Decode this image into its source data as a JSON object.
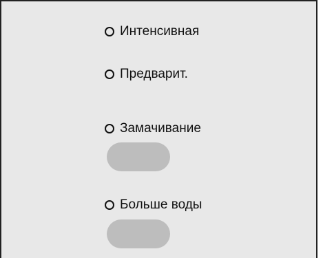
{
  "panel": {
    "background": "#e8e8e8",
    "options": [
      {
        "label": "Интенсивная"
      },
      {
        "label": "Предварит."
      },
      {
        "label": "Замачивание"
      },
      {
        "label": "Больше воды"
      }
    ],
    "pill_color": "#bdbdbd"
  }
}
